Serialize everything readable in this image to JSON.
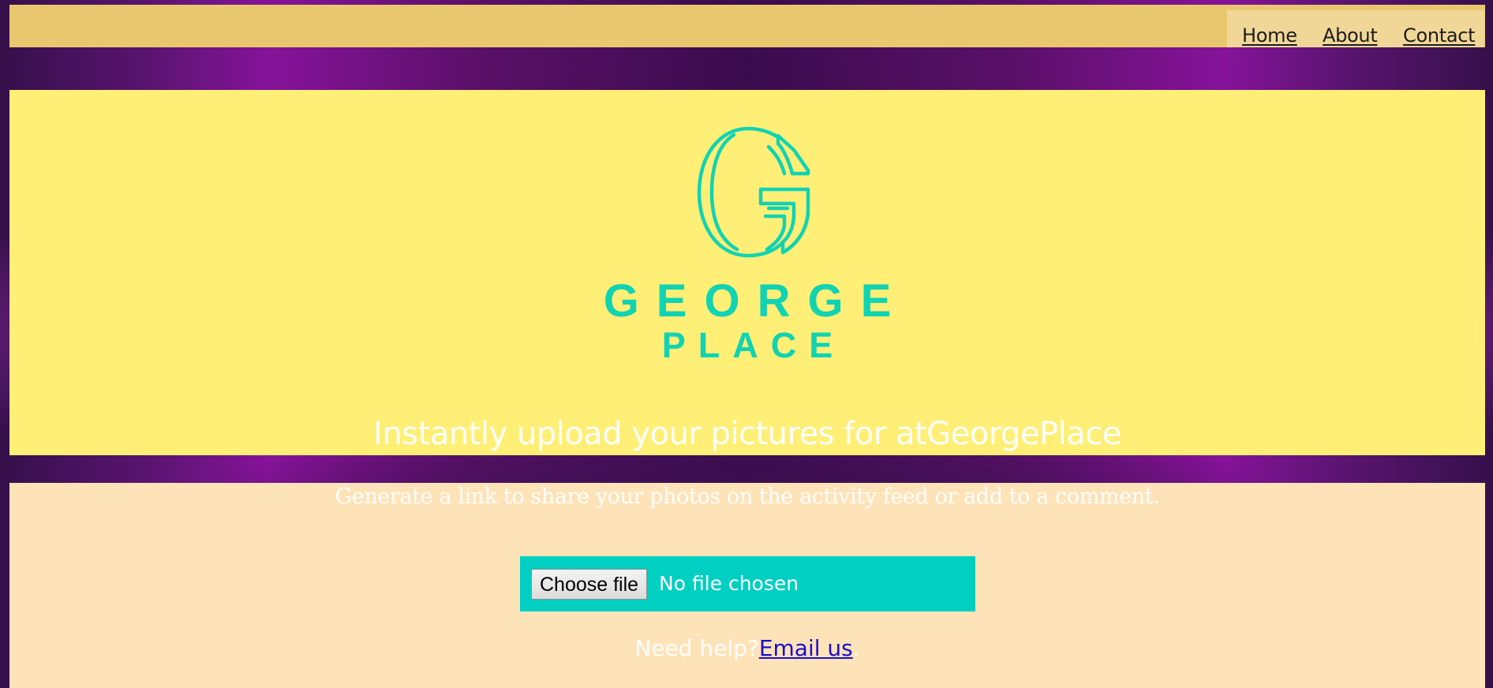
{
  "nav": {
    "items": [
      {
        "label": "Home"
      },
      {
        "label": "About"
      },
      {
        "label": "Contact"
      }
    ]
  },
  "hero": {
    "logo": {
      "icon": "g-monogram-icon",
      "line1": "GEORGE",
      "line2": "PLACE",
      "color": "#10d3b3"
    },
    "title": "Instantly upload your pictures for atGeorgePlace"
  },
  "content": {
    "subtitle": "Generate a link to share your photos on the activity feed or add to a comment.",
    "upload": {
      "button_label": "Choose file",
      "status": "No file chosen"
    },
    "help": {
      "prefix": "Need help?",
      "link_label": "Email us",
      "suffix": "."
    }
  },
  "colors": {
    "top_bar": "#e9c76e",
    "hero_bg": "#ffef76",
    "content_bg": "#ffe3b8",
    "upload_bg": "#00cfc1",
    "link": "#1a0dcc"
  }
}
